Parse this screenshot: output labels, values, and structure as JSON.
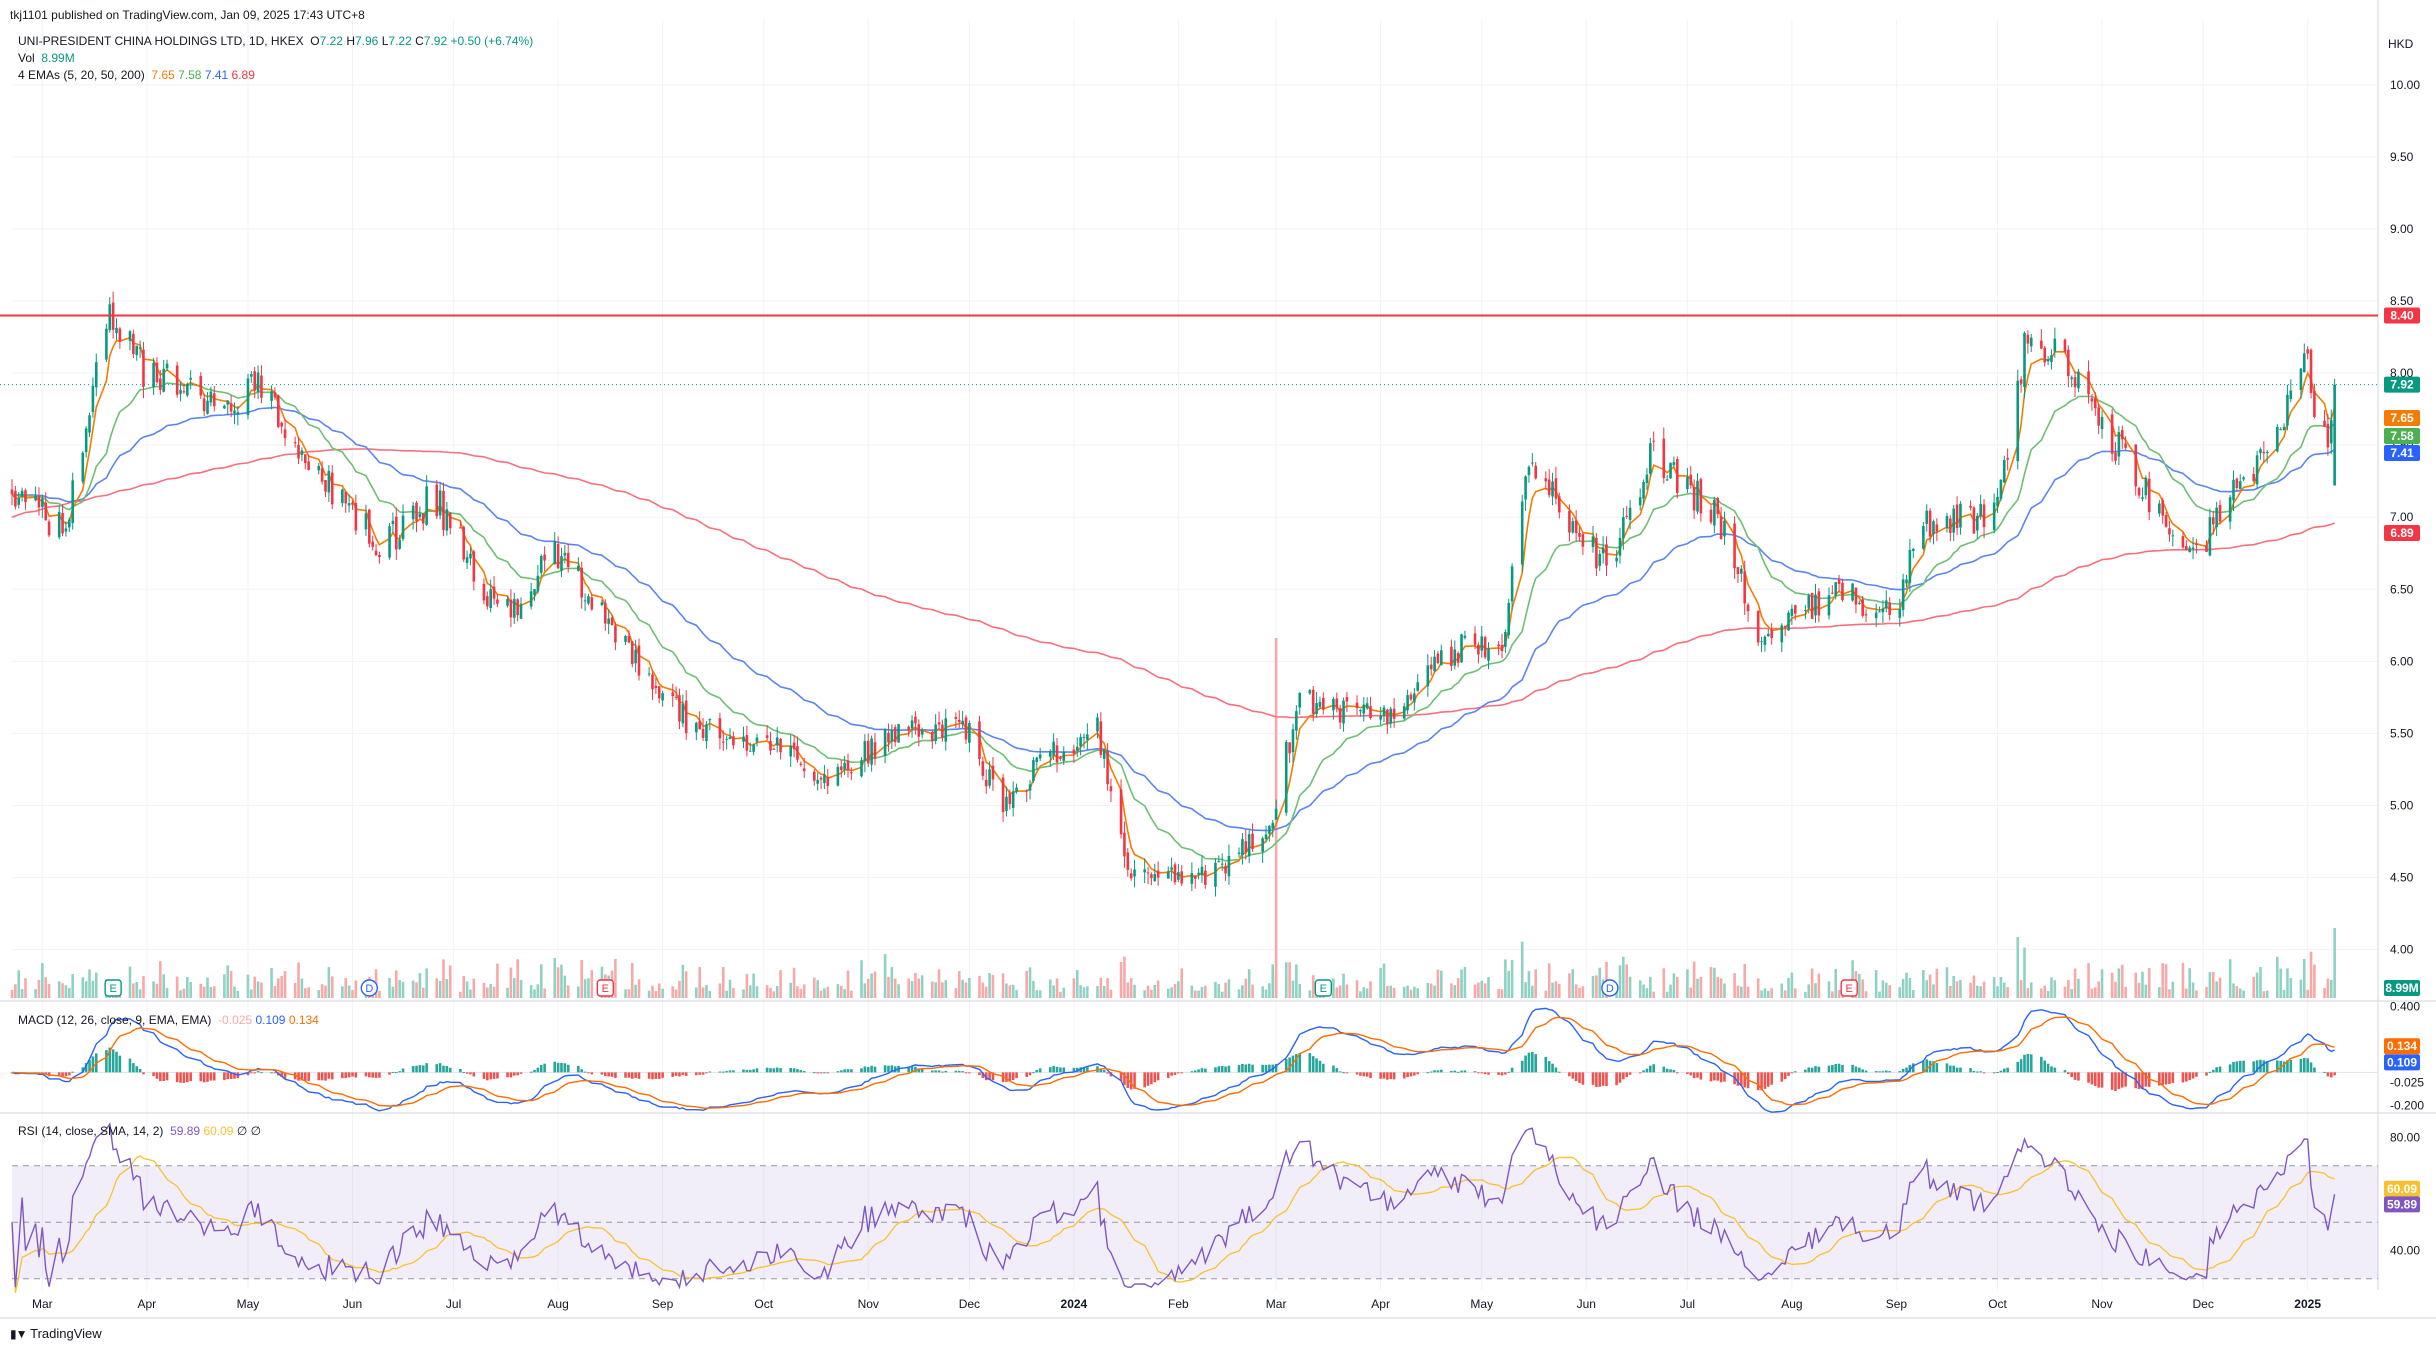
{
  "header": {
    "published": "tkj1101 published on TradingView.com, Jan 09, 2025 17:43 UTC+8",
    "symbol": "UNI-PRESIDENT CHINA HOLDINGS LTD, 1D, HKEX",
    "ohlc": {
      "o_label": "O",
      "o": "7.22",
      "h_label": "H",
      "h": "7.96",
      "l_label": "L",
      "l": "7.22",
      "c_label": "C",
      "c": "7.92",
      "chg": "+0.50 (+6.74%)"
    },
    "vol_label": "Vol",
    "vol_value": "8.99M",
    "ema_label": "4 EMAs (5, 20, 50, 200)",
    "ema_values": [
      "7.65",
      "7.58",
      "7.41",
      "6.89"
    ],
    "currency": "HKD"
  },
  "indicators": {
    "macd_label": "MACD (12, 26, close, 9, EMA, EMA)",
    "macd_values": [
      "-0.025",
      "0.109",
      "0.134"
    ],
    "rsi_label": "RSI (14, close, SMA, 14, 2)",
    "rsi_values": [
      "59.89",
      "60.09",
      "∅",
      "∅"
    ]
  },
  "footer": {
    "brand": "TradingView"
  },
  "colors": {
    "up": "#089981",
    "down": "#f23645",
    "ema5": "#f57c00",
    "ema20": "#4caf50",
    "ema50": "#2962ff",
    "ema200": "#f23645",
    "macd": "#2962ff",
    "signal": "#ff6d00",
    "rsi": "#7e57c2",
    "rsi_ma": "#fbc02d",
    "resistance": "#f23645"
  },
  "chart_data": [
    {
      "type": "candlestick",
      "title": "UNI-PRESIDENT CHINA HOLDINGS LTD, 1D, HKEX",
      "x_ticks": [
        "Mar",
        "Apr",
        "May",
        "Jun",
        "Jul",
        "Aug",
        "Sep",
        "Oct",
        "Nov",
        "Dec",
        "2024",
        "Feb",
        "Mar",
        "Apr",
        "May",
        "Jun",
        "Jul",
        "Aug",
        "Sep",
        "Oct",
        "Nov",
        "Dec",
        "2025"
      ],
      "y_ticks": [
        "4.00",
        "4.50",
        "5.00",
        "5.50",
        "6.00",
        "6.50",
        "7.00",
        "7.50",
        "8.00",
        "8.50",
        "9.00",
        "9.50",
        "10.00"
      ],
      "y_range": [
        3.65,
        10.45
      ],
      "price_path": [
        [
          "2023-02-20",
          7.2
        ],
        [
          "2023-03-08",
          6.9
        ],
        [
          "2023-03-20",
          8.45
        ],
        [
          "2023-03-31",
          8.0
        ],
        [
          "2023-04-20",
          7.8
        ],
        [
          "2023-05-05",
          7.9
        ],
        [
          "2023-05-25",
          7.2
        ],
        [
          "2023-06-10",
          6.8
        ],
        [
          "2023-06-25",
          7.15
        ],
        [
          "2023-07-15",
          6.3
        ],
        [
          "2023-08-01",
          6.75
        ],
        [
          "2023-08-25",
          5.95
        ],
        [
          "2023-09-10",
          5.55
        ],
        [
          "2023-09-30",
          5.45
        ],
        [
          "2023-10-20",
          5.2
        ],
        [
          "2023-11-10",
          5.5
        ],
        [
          "2023-11-30",
          5.55
        ],
        [
          "2023-12-10",
          5.0
        ],
        [
          "2023-12-25",
          5.35
        ],
        [
          "2024-01-08",
          5.55
        ],
        [
          "2024-01-18",
          4.5
        ],
        [
          "2024-02-10",
          4.5
        ],
        [
          "2024-02-28",
          4.85
        ],
        [
          "2024-03-08",
          5.75
        ],
        [
          "2024-03-31",
          5.6
        ],
        [
          "2024-04-25",
          6.1
        ],
        [
          "2024-05-08",
          6.15
        ],
        [
          "2024-05-14",
          7.35
        ],
        [
          "2024-05-31",
          6.9
        ],
        [
          "2024-06-08",
          6.6
        ],
        [
          "2024-06-20",
          7.45
        ],
        [
          "2024-07-10",
          7.0
        ],
        [
          "2024-07-22",
          6.2
        ],
        [
          "2024-08-15",
          6.5
        ],
        [
          "2024-08-31",
          6.3
        ],
        [
          "2024-09-08",
          6.95
        ],
        [
          "2024-09-30",
          7.0
        ],
        [
          "2024-10-10",
          8.3
        ],
        [
          "2024-10-28",
          7.85
        ],
        [
          "2024-11-10",
          7.3
        ],
        [
          "2024-11-29",
          6.75
        ],
        [
          "2024-12-10",
          7.2
        ],
        [
          "2024-12-20",
          7.4
        ],
        [
          "2024-12-31",
          8.1
        ],
        [
          "2025-01-07",
          7.42
        ],
        [
          "2025-01-09",
          7.92
        ]
      ],
      "last": {
        "open": 7.22,
        "high": 7.96,
        "low": 7.22,
        "close": 7.92
      },
      "resistance_level": 8.4,
      "price_tags": [
        {
          "value": "8.40",
          "color": "#f23645"
        },
        {
          "value": "7.92",
          "color": "#089981"
        },
        {
          "value": "7.65",
          "color": "#f57c00"
        },
        {
          "value": "7.58",
          "color": "#4caf50"
        },
        {
          "value": "7.41",
          "color": "#2962ff"
        },
        {
          "value": "6.89",
          "color": "#f23645"
        }
      ],
      "volume_tag": "8.99M",
      "event_markers": [
        {
          "date": "2023-03-22",
          "letter": "E",
          "color": "#089981"
        },
        {
          "date": "2023-06-06",
          "letter": "D",
          "color": "#2962ff"
        },
        {
          "date": "2023-08-15",
          "letter": "E",
          "color": "#f23645"
        },
        {
          "date": "2024-03-15",
          "letter": "E",
          "color": "#089981"
        },
        {
          "date": "2024-06-08",
          "letter": "D",
          "color": "#2962ff"
        },
        {
          "date": "2024-08-18",
          "letter": "E",
          "color": "#f23645"
        }
      ]
    },
    {
      "type": "bar",
      "title": "MACD (12, 26, close, 9, EMA, EMA)",
      "y_ticks": [
        "0.400",
        "-0.200"
      ],
      "y_range": [
        -0.24,
        0.42
      ],
      "series": [
        {
          "name": "MACD",
          "value": "0.109"
        },
        {
          "name": "Signal",
          "value": "0.134"
        },
        {
          "name": "Histogram",
          "value": "-0.025"
        }
      ]
    },
    {
      "type": "line",
      "title": "RSI (14, close, SMA, 14, 2)",
      "y_ticks": [
        "80.00",
        "40.00"
      ],
      "y_range": [
        26,
        88
      ],
      "bands": {
        "upper": 70,
        "middle": 50,
        "lower": 30
      },
      "series": [
        {
          "name": "RSI",
          "value": "59.89"
        },
        {
          "name": "RSI-based MA",
          "value": "60.09"
        }
      ]
    }
  ]
}
